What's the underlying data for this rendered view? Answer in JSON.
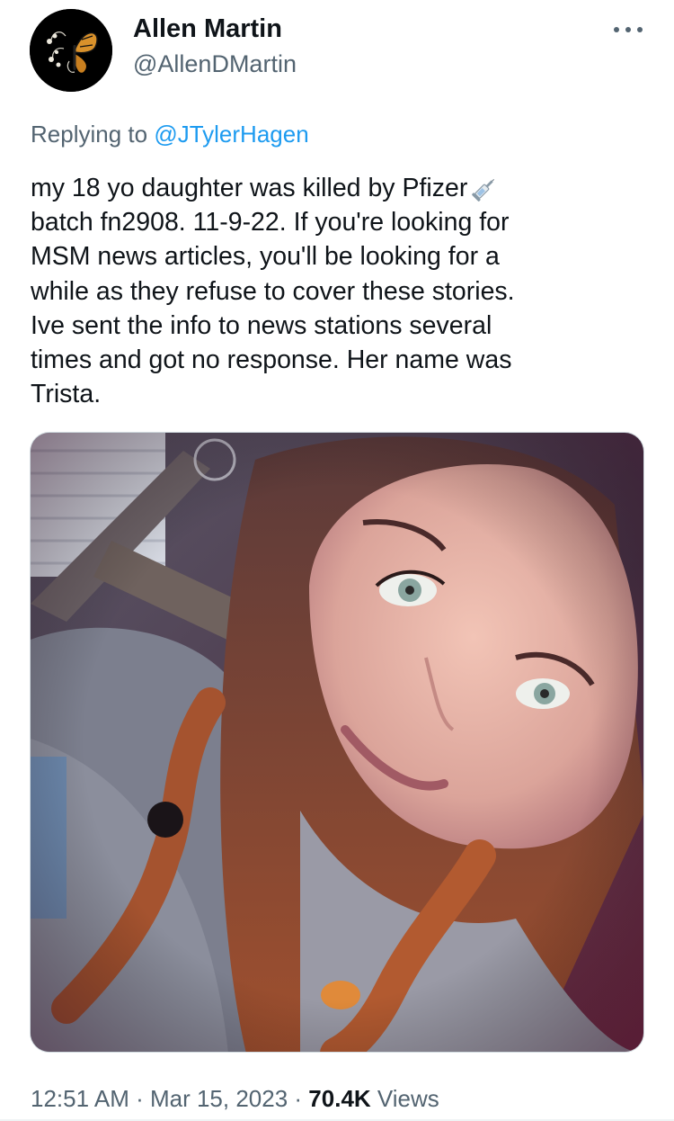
{
  "author": {
    "display_name": "Allen Martin",
    "handle": "@AllenDMartin"
  },
  "reply": {
    "prefix": "Replying to",
    "mention": "@JTylerHagen"
  },
  "tweet": {
    "lines": [
      "my 18 yo daughter was killed by Pfizer",
      "batch fn2908. 11-9-22. If you're looking for",
      "MSM news articles, you'll be looking for a",
      "while as they refuse to cover these stories.",
      "Ive sent the info to news stations several",
      "times and got no response. Her name was",
      "Trista."
    ],
    "emoji": "syringe-icon"
  },
  "meta": {
    "time": "12:51 AM",
    "separator_1": " · ",
    "date": "Mar 15, 2023",
    "separator_2": " · ",
    "views_count": "70.4K",
    "views_label": " Views"
  },
  "colors": {
    "link": "#1d9bf0",
    "secondary_text": "#536471",
    "primary_text": "#0f1419"
  }
}
